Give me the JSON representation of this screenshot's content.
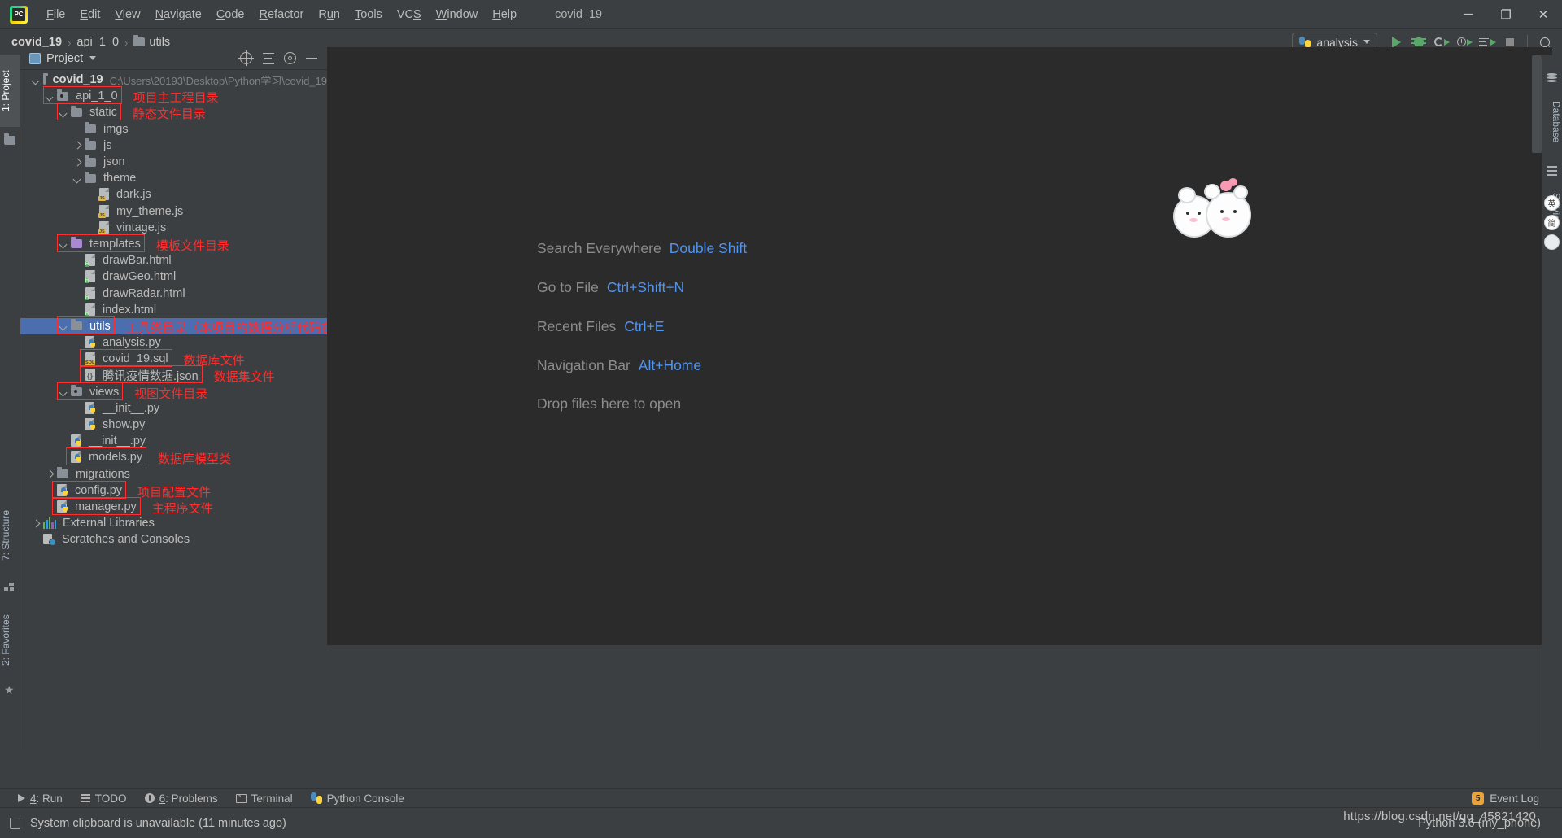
{
  "window": {
    "title": "covid_19",
    "minimize": "─",
    "maximize": "❐",
    "close": "✕"
  },
  "menubar": {
    "logo": "pycharm-logo",
    "items": [
      {
        "label": "File",
        "mnemonic": "F"
      },
      {
        "label": "Edit",
        "mnemonic": "E"
      },
      {
        "label": "View",
        "mnemonic": "V"
      },
      {
        "label": "Navigate",
        "mnemonic": "N"
      },
      {
        "label": "Code",
        "mnemonic": "C"
      },
      {
        "label": "Refactor",
        "mnemonic": "R"
      },
      {
        "label": "Run",
        "mnemonic": "u"
      },
      {
        "label": "Tools",
        "mnemonic": "T"
      },
      {
        "label": "VCS",
        "mnemonic": "S"
      },
      {
        "label": "Window",
        "mnemonic": "W"
      },
      {
        "label": "Help",
        "mnemonic": "H"
      }
    ]
  },
  "navbar": {
    "breadcrumbs": [
      {
        "label": "covid_19",
        "bold": true,
        "icon": ""
      },
      {
        "label": "api_1_0",
        "bold": false,
        "icon": ""
      },
      {
        "label": "utils",
        "bold": false,
        "icon": "folder-icon"
      }
    ],
    "separator": "›"
  },
  "toolbar": {
    "run_configuration": "analysis",
    "buttons": [
      {
        "name": "run-button",
        "tooltip": "Run"
      },
      {
        "name": "debug-button",
        "tooltip": "Debug"
      },
      {
        "name": "run-with-coverage-button",
        "tooltip": "Run with Coverage"
      },
      {
        "name": "profile-button",
        "tooltip": "Profile"
      },
      {
        "name": "run-with-console-button",
        "tooltip": "Run Console"
      },
      {
        "name": "stop-button",
        "tooltip": "Stop"
      },
      {
        "name": "search-button",
        "tooltip": "Search"
      }
    ]
  },
  "left_strip": {
    "tabs": [
      {
        "label": "1: Project",
        "active": true
      },
      {
        "label": "7: Structure",
        "active": false
      },
      {
        "label": "2: Favorites",
        "active": false
      }
    ]
  },
  "right_strip": {
    "tabs": [
      {
        "label": "Database"
      },
      {
        "label": "SciView"
      }
    ],
    "ime": [
      "英",
      "简"
    ]
  },
  "project_panel": {
    "title": "Project",
    "header_actions": [
      {
        "name": "locate-icon"
      },
      {
        "name": "collapse-all-icon"
      },
      {
        "name": "settings-gear-icon"
      },
      {
        "name": "hide-icon"
      }
    ],
    "tree": [
      {
        "id": "covid_19",
        "label": "covid_19",
        "path": "C:\\Users\\20193\\Desktop\\Python学习\\covid_19",
        "indent": 0,
        "arrow": "down",
        "icon": "folder",
        "bold": true,
        "selected": false
      },
      {
        "id": "api_1_0",
        "label": "api_1_0",
        "indent": 1,
        "arrow": "down",
        "icon": "folder-module",
        "bold": false,
        "selected": false,
        "annotation": "项目主工程目录",
        "boxed": true
      },
      {
        "id": "static",
        "label": "static",
        "indent": 2,
        "arrow": "down",
        "icon": "folder",
        "bold": false,
        "selected": false,
        "annotation": "静态文件目录",
        "boxed": true
      },
      {
        "id": "imgs",
        "label": "imgs",
        "indent": 3,
        "arrow": "none",
        "icon": "folder",
        "selected": false
      },
      {
        "id": "js",
        "label": "js",
        "indent": 3,
        "arrow": "right",
        "icon": "folder",
        "selected": false
      },
      {
        "id": "json",
        "label": "json",
        "indent": 3,
        "arrow": "right",
        "icon": "folder",
        "selected": false
      },
      {
        "id": "theme",
        "label": "theme",
        "indent": 3,
        "arrow": "down",
        "icon": "folder",
        "selected": false
      },
      {
        "id": "dark.js",
        "label": "dark.js",
        "indent": 4,
        "arrow": "none",
        "icon": "js",
        "selected": false
      },
      {
        "id": "my_theme.js",
        "label": "my_theme.js",
        "indent": 4,
        "arrow": "none",
        "icon": "js",
        "selected": false
      },
      {
        "id": "vintage.js",
        "label": "vintage.js",
        "indent": 4,
        "arrow": "none",
        "icon": "js",
        "selected": false
      },
      {
        "id": "templates",
        "label": "templates",
        "indent": 2,
        "arrow": "down",
        "icon": "folder-purple",
        "selected": false,
        "annotation": "模板文件目录",
        "boxed": true
      },
      {
        "id": "drawBar.html",
        "label": "drawBar.html",
        "indent": 3,
        "arrow": "none",
        "icon": "html",
        "selected": false
      },
      {
        "id": "drawGeo.html",
        "label": "drawGeo.html",
        "indent": 3,
        "arrow": "none",
        "icon": "html",
        "selected": false
      },
      {
        "id": "drawRadar.html",
        "label": "drawRadar.html",
        "indent": 3,
        "arrow": "none",
        "icon": "html",
        "selected": false
      },
      {
        "id": "index.html",
        "label": "index.html",
        "indent": 3,
        "arrow": "none",
        "icon": "html",
        "selected": false
      },
      {
        "id": "utils",
        "label": "utils",
        "indent": 2,
        "arrow": "down",
        "icon": "folder",
        "selected": true,
        "annotation": "工具类目录（本项目的数据分析代码在此项目的analysis.py文件中）",
        "boxed": true
      },
      {
        "id": "analysis.py",
        "label": "analysis.py",
        "indent": 3,
        "arrow": "none",
        "icon": "py",
        "selected": false
      },
      {
        "id": "covid_19.sql",
        "label": "covid_19.sql",
        "indent": 3,
        "arrow": "none",
        "icon": "sql",
        "selected": false,
        "annotation": "数据库文件",
        "boxed": true
      },
      {
        "id": "tencent.json",
        "label": "腾讯疫情数据.json",
        "indent": 3,
        "arrow": "none",
        "icon": "json",
        "selected": false,
        "annotation": "数据集文件",
        "boxed": true
      },
      {
        "id": "views",
        "label": "views",
        "indent": 2,
        "arrow": "down",
        "icon": "folder-module",
        "selected": false,
        "annotation": "视图文件目录",
        "boxed": true
      },
      {
        "id": "views__init__",
        "label": "__init__.py",
        "indent": 3,
        "arrow": "none",
        "icon": "py",
        "selected": false
      },
      {
        "id": "show.py",
        "label": "show.py",
        "indent": 3,
        "arrow": "none",
        "icon": "py",
        "selected": false
      },
      {
        "id": "api__init__",
        "label": "__init__.py",
        "indent": 2,
        "arrow": "none",
        "icon": "py",
        "selected": false
      },
      {
        "id": "models.py",
        "label": "models.py",
        "indent": 2,
        "arrow": "none",
        "icon": "py",
        "selected": false,
        "annotation": "数据库模型类",
        "boxed": true
      },
      {
        "id": "migrations",
        "label": "migrations",
        "indent": 1,
        "arrow": "right",
        "icon": "folder",
        "selected": false
      },
      {
        "id": "config.py",
        "label": "config.py",
        "indent": 1,
        "arrow": "none",
        "icon": "py",
        "selected": false,
        "annotation": "项目配置文件",
        "boxed": true
      },
      {
        "id": "manager.py",
        "label": "manager.py",
        "indent": 1,
        "arrow": "none",
        "icon": "py",
        "selected": false,
        "annotation": "主程序文件",
        "boxed": true
      },
      {
        "id": "external",
        "label": "External Libraries",
        "indent": 0,
        "arrow": "right",
        "icon": "library",
        "selected": false
      },
      {
        "id": "scratches",
        "label": "Scratches and Consoles",
        "indent": 0,
        "arrow": "none",
        "icon": "scratch",
        "selected": false
      }
    ]
  },
  "editor": {
    "hints": [
      {
        "action": "Search Everywhere",
        "shortcut": "Double Shift"
      },
      {
        "action": "Go to File",
        "shortcut": "Ctrl+Shift+N"
      },
      {
        "action": "Recent Files",
        "shortcut": "Ctrl+E"
      },
      {
        "action": "Navigation Bar",
        "shortcut": "Alt+Home"
      }
    ],
    "drop_text": "Drop files here to open"
  },
  "tool_window_bar": {
    "items": [
      {
        "label": "4: Run",
        "mnemonic": "4",
        "icon": "run-icon"
      },
      {
        "label": "TODO",
        "mnemonic": "",
        "icon": "todo-icon"
      },
      {
        "label": "6: Problems",
        "mnemonic": "6",
        "icon": "problems-icon"
      },
      {
        "label": "Terminal",
        "mnemonic": "",
        "icon": "terminal-icon"
      },
      {
        "label": "Python Console",
        "mnemonic": "",
        "icon": "python-icon"
      }
    ],
    "event_log": {
      "label": "Event Log",
      "count": "5"
    }
  },
  "status_bar": {
    "message": "System clipboard is unavailable (11 minutes ago)",
    "interpreter": "Python 3.6 (my_phone)",
    "watermark": "https://blog.csdn.net/qq_45821420"
  },
  "colors": {
    "accent_selection": "#4b6eaf",
    "annotation_red": "#ff2d2d",
    "shortcut_blue": "#5394ec",
    "panel_bg": "#3c3f41",
    "editor_bg": "#2b2b2b",
    "green_run": "#59a869"
  }
}
